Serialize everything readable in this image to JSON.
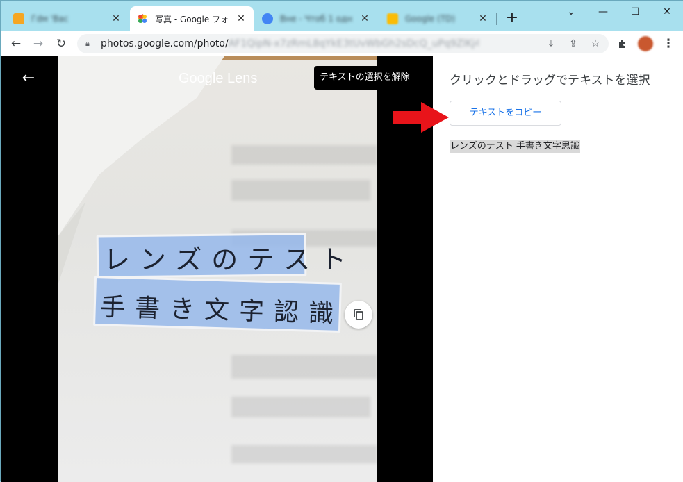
{
  "browser": {
    "tabs": [
      {
        "title": "Гdм 'Вас",
        "active": false,
        "blurred": true,
        "favicon_color": "#f5a623"
      },
      {
        "title": "写真 - Google フォト",
        "active": true,
        "blurred": false,
        "favicon_color": "#ea4335"
      },
      {
        "title": "Вне - Чтоб 1 одн",
        "active": false,
        "blurred": true,
        "favicon_color": "#4285f4"
      },
      {
        "title": "Google (TD)",
        "active": false,
        "blurred": true,
        "favicon_color": "#fbbc05"
      }
    ],
    "new_tab_label": "+",
    "url_host": "photos.google.com/photo/",
    "url_path": "AF1QipN-x7zRmL8qYkE3tUvWbGh2sDcQ_uPq9ZlKj4nMa0o"
  },
  "lens": {
    "title": "Google Lens",
    "unselect_label": "テキストの選択を解除",
    "handwriting_line1": "レンズのテスト",
    "handwriting_line2": "手書き文字認識"
  },
  "panel": {
    "title": "クリックとドラッグでテキストを選択",
    "copy_button": "テキストをコピー",
    "recognized_text": "レンズのテスト 手書き文字思識"
  },
  "colors": {
    "accent": "#1a73e8",
    "annotation_arrow": "#e8141a",
    "highlight": "#96b9eb"
  }
}
